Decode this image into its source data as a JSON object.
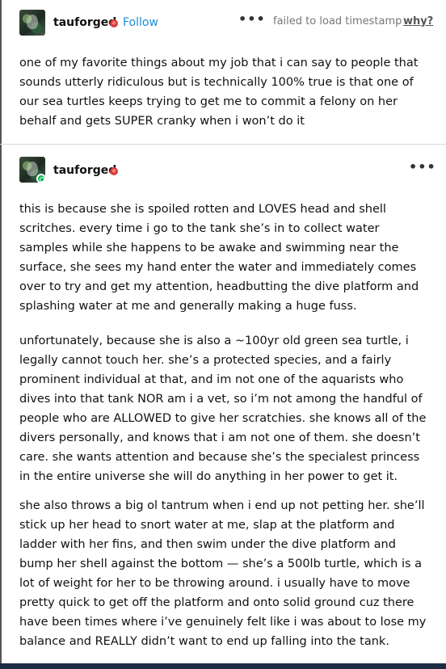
{
  "post": {
    "author": "tauforged",
    "follow_label": "Follow",
    "more_label": "•••",
    "timestamp_text": "failed to load timestamp",
    "why_label": "why?",
    "body": "one of my favorite things about my job that i can say to people that sounds utterly ridiculous but is technically 100% true is that one of our sea turtles keeps trying to get me to commit a felony on her behalf and gets SUPER cranky when i won’t do it"
  },
  "reblog": {
    "author": "tauforged",
    "more_label": "•••",
    "paragraphs": [
      "this is because she is spoiled rotten and LOVES head and shell scritches. every time i go to the tank she’s in to collect water samples while she happens to be awake and swimming near the surface, she sees my hand enter the water and immediately comes over to try and get my attention, headbutting the dive platform and splashing water at me and generally making a huge fuss.",
      "unfortunately, because she is also a ~100yr old green sea turtle, i legally cannot touch her. she’s a protected species, and a fairly prominent individual at that, and im not one of the aquarists who dives into that tank NOR am i a vet, so i’m not among the handful of people who are ALLOWED to give her scratchies. she knows all of the divers personally, and knows that i am not one of them. she doesn’t care. she wants attention and because she’s the specialest princess in the entire universe she will do anything in her power to get it.",
      "she also throws a big ol tantrum when i end up not petting her. she’ll stick up her head to snort water at me, slap at the platform and ladder with her fins, and then swim under the dive platform and bump her shell against the bottom — she’s a 500lb turtle, which is a lot of weight for her to be throwing around. i usually have to move pretty quick to get off the platform and onto solid ground cuz there have been times where i’ve genuinely felt like i was about to lose my balance and REALLY didn’t want to end up falling into the tank."
    ]
  },
  "colors": {
    "accent": "#1a8cd8",
    "reblog_badge": "#00b853",
    "heart_badge": "#d63b3b",
    "bottom_bar": "#1d2d44"
  }
}
